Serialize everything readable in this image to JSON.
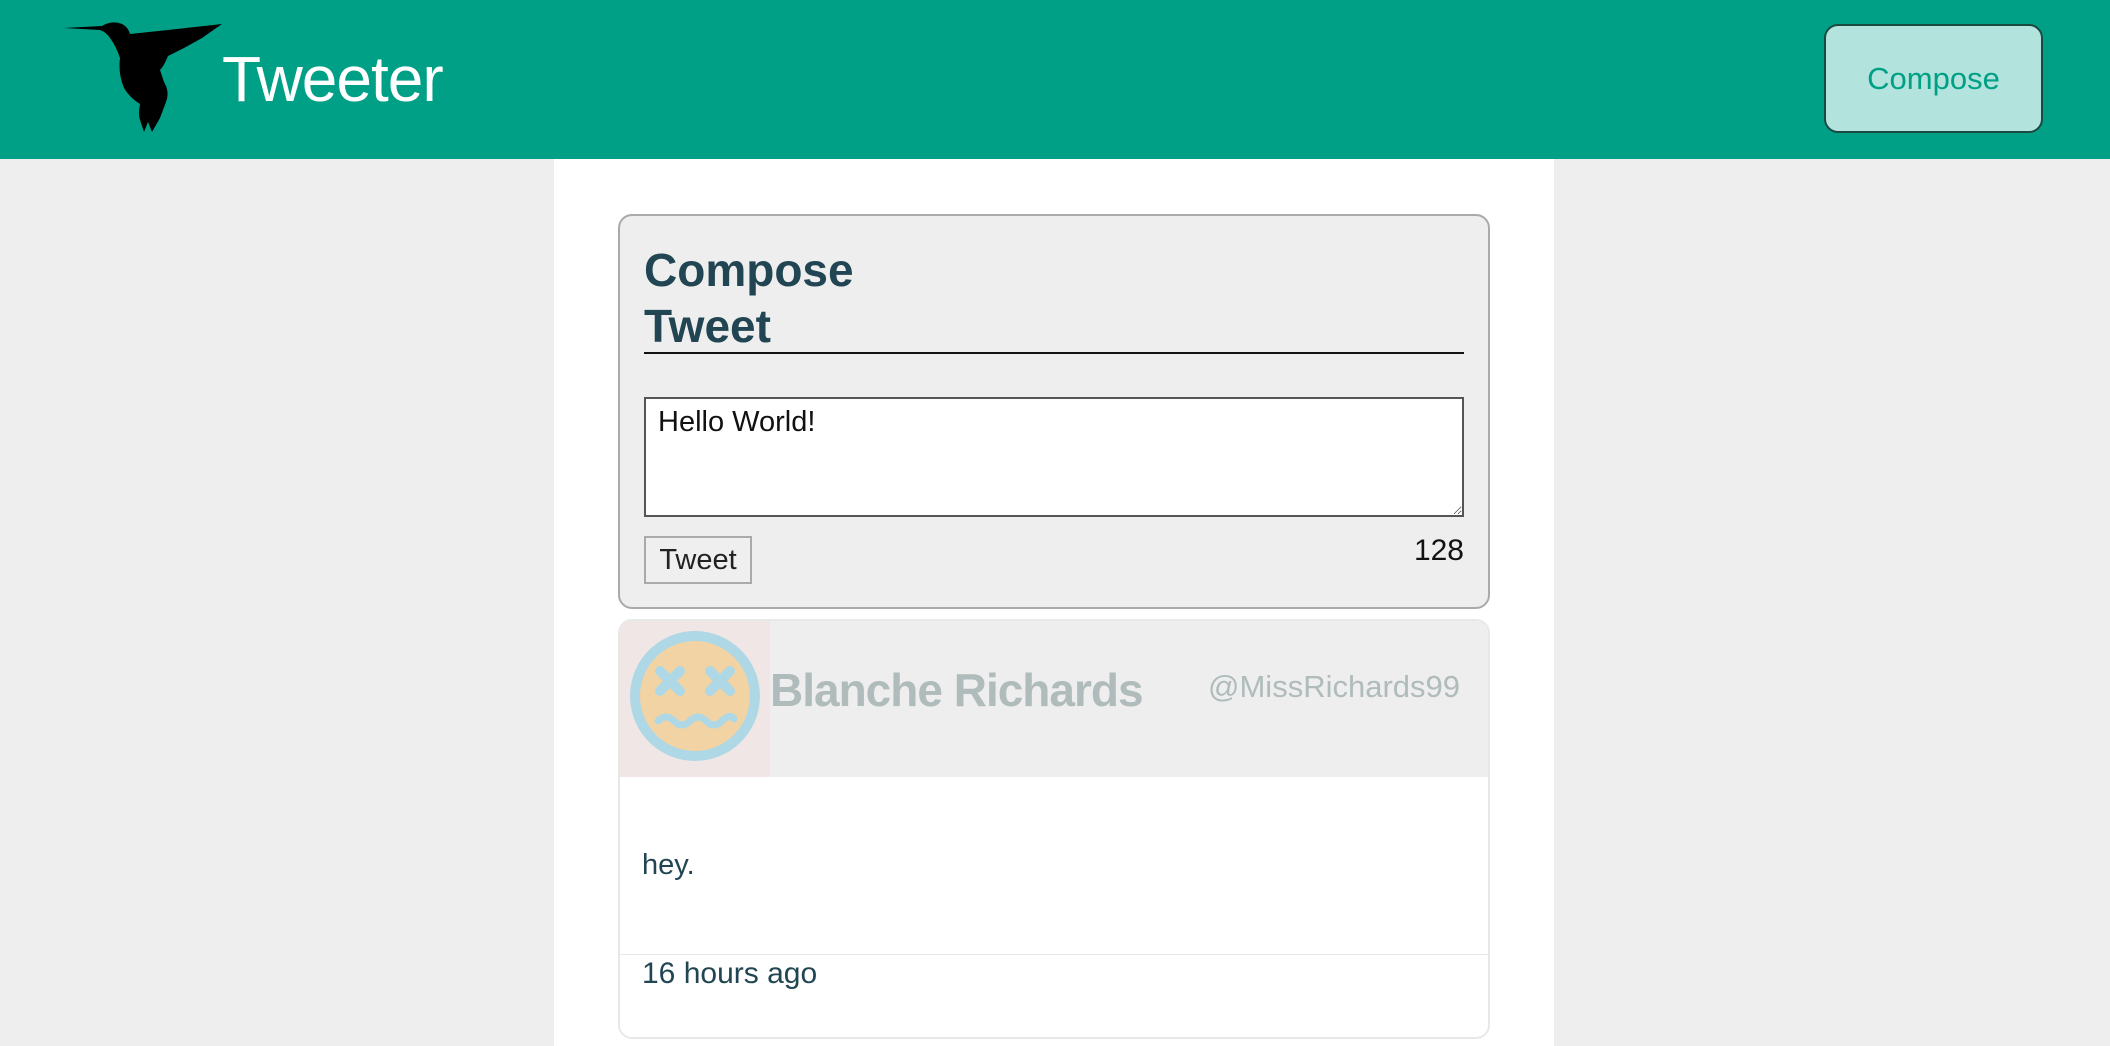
{
  "nav": {
    "brand": "Tweeter",
    "logo_icon": "hummingbird-icon",
    "compose_label": "Compose"
  },
  "compose": {
    "title": "Compose Tweet",
    "textarea_value": "Hello World!",
    "submit_label": "Tweet",
    "counter": "128"
  },
  "tweets": [
    {
      "avatar_icon": "dizzy-face-avatar-icon",
      "name": "Blanche Richards",
      "handle": "@MissRichards99",
      "content": "hey.",
      "time": "16 hours ago"
    }
  ],
  "colors": {
    "nav_bg": "#00a087",
    "compose_btn_bg": "#b2e3dc",
    "compose_btn_text": "#00a087",
    "heading_text": "#214552",
    "page_bg": "#eeeeee",
    "avatar_ring": "#aed8e6",
    "avatar_face": "#f2d3a4"
  }
}
